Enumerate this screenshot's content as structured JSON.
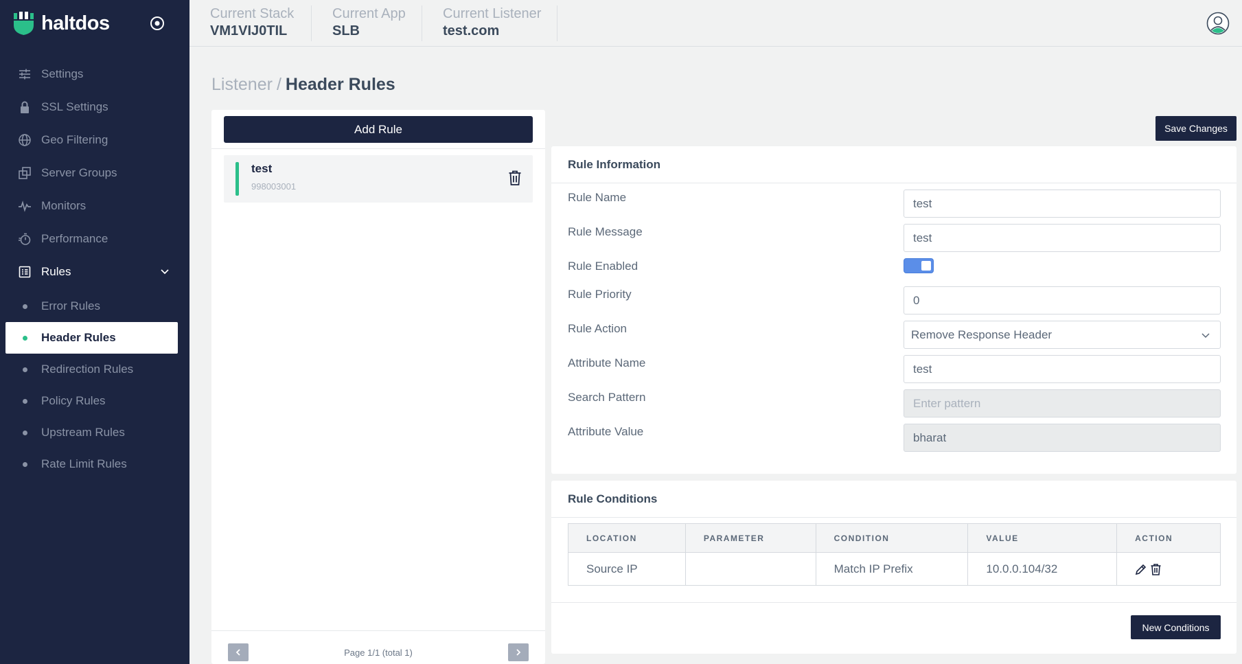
{
  "brand": {
    "name": "haltdos"
  },
  "header": {
    "stack": {
      "label": "Current Stack",
      "value": "VM1VIJ0TIL"
    },
    "app": {
      "label": "Current App",
      "value": "SLB"
    },
    "listener": {
      "label": "Current Listener",
      "value": "test.com"
    }
  },
  "sidebar": {
    "items": [
      {
        "label": "Settings",
        "icon": "sliders-icon"
      },
      {
        "label": "SSL Settings",
        "icon": "lock-icon"
      },
      {
        "label": "Geo Filtering",
        "icon": "globe-icon"
      },
      {
        "label": "Server Groups",
        "icon": "copy-icon"
      },
      {
        "label": "Monitors",
        "icon": "pulse-icon"
      },
      {
        "label": "Performance",
        "icon": "stopwatch-icon"
      },
      {
        "label": "Rules",
        "icon": "list-icon"
      }
    ],
    "rules_sub": [
      {
        "label": "Error Rules"
      },
      {
        "label": "Header Rules"
      },
      {
        "label": "Redirection Rules"
      },
      {
        "label": "Policy Rules"
      },
      {
        "label": "Upstream Rules"
      },
      {
        "label": "Rate Limit Rules"
      }
    ],
    "current_sub": "Header Rules"
  },
  "breadcrumb": {
    "parent": "Listener",
    "separator": "/",
    "current": "Header Rules"
  },
  "rules_panel": {
    "add_label": "Add Rule",
    "rules": [
      {
        "name": "test",
        "id": "998003001"
      }
    ],
    "pager": "Page 1/1 (total 1)"
  },
  "save_label": "Save Changes",
  "rule_info": {
    "title": "Rule Information",
    "name_label": "Rule Name",
    "name_value": "test",
    "message_label": "Rule Message",
    "message_value": "test",
    "enabled_label": "Rule Enabled",
    "enabled": true,
    "priority_label": "Rule Priority",
    "priority_value": "0",
    "action_label": "Rule Action",
    "action_value": "Remove Response Header",
    "attr_name_label": "Attribute Name",
    "attr_name_value": "test",
    "search_label": "Search Pattern",
    "search_placeholder": "Enter pattern",
    "attr_value_label": "Attribute Value",
    "attr_value_value": "bharat"
  },
  "conditions": {
    "title": "Rule Conditions",
    "columns": [
      "LOCATION",
      "PARAMETER",
      "CONDITION",
      "VALUE",
      "ACTION"
    ],
    "rows": [
      {
        "location": "Source IP",
        "parameter": "",
        "condition": "Match IP Prefix",
        "value": "10.0.0.104/32"
      }
    ],
    "new_label": "New Conditions"
  },
  "colors": {
    "sidebar_bg": "#1c2541",
    "accent_green": "#2bbf8a",
    "toggle_blue": "#5b8ee8",
    "page_bg": "#f1f2f2"
  }
}
